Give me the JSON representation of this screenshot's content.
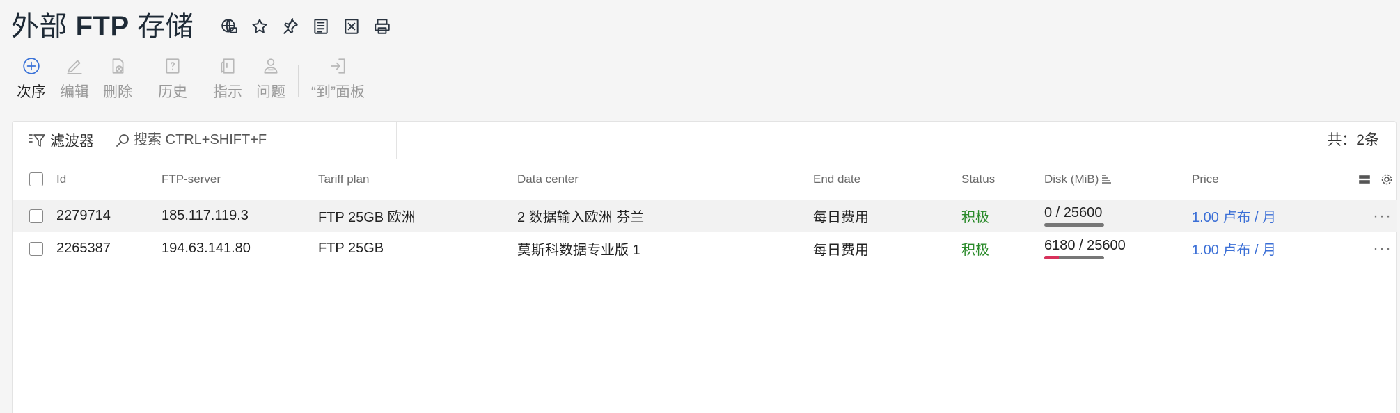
{
  "header": {
    "title_prefix": "外部 ",
    "title_bold": "FTP",
    "title_suffix": " 存储",
    "icons": [
      "globe-icon",
      "star-icon",
      "pin-icon",
      "list-doc-icon",
      "excel-export-icon",
      "print-icon"
    ]
  },
  "toolbar": {
    "items": [
      {
        "label": "次序",
        "icon": "add-circle-icon",
        "active": true
      },
      {
        "label": "编辑",
        "icon": "pencil-icon",
        "active": false
      },
      {
        "label": "删除",
        "icon": "delete-doc-icon",
        "active": false
      },
      {
        "label": "历史",
        "icon": "history-doc-icon",
        "active": false
      },
      {
        "label": "指示",
        "icon": "instruction-icon",
        "active": false
      },
      {
        "label": "问题",
        "icon": "support-user-icon",
        "active": false
      },
      {
        "label": "“到”面板",
        "icon": "login-panel-icon",
        "active": false
      }
    ]
  },
  "filterbar": {
    "filter_label": "滤波器",
    "search_placeholder": "搜索 CTRL+SHIFT+F",
    "total": "共：2条"
  },
  "table": {
    "columns": [
      "Id",
      "FTP-server",
      "Tariff plan",
      "Data center",
      "End date",
      "Status",
      "Disk (MiB)",
      "Price"
    ],
    "rows": [
      {
        "id": "2279714",
        "ftp_server": "185.117.119.3",
        "tariff_plan": "FTP 25GB 欧洲",
        "data_center": "2 数据输入欧洲 芬兰",
        "end_date": "每日费用",
        "status": "积极",
        "disk": "0 / 25600",
        "disk_fraction": 0,
        "price": "1.00 卢布 / 月"
      },
      {
        "id": "2265387",
        "ftp_server": "194.63.141.80",
        "tariff_plan": "FTP 25GB",
        "data_center": "莫斯科数据专业版 1",
        "end_date": "每日费用",
        "status": "积极",
        "disk": "6180 / 25600",
        "disk_fraction": 0.2414,
        "price": "1.00 卢布 / 月"
      }
    ]
  },
  "colors": {
    "accent": "#3b73d8",
    "status_active": "#2a8a2a",
    "price_link": "#3b6fd6",
    "disk_fill": "#d8315b"
  }
}
